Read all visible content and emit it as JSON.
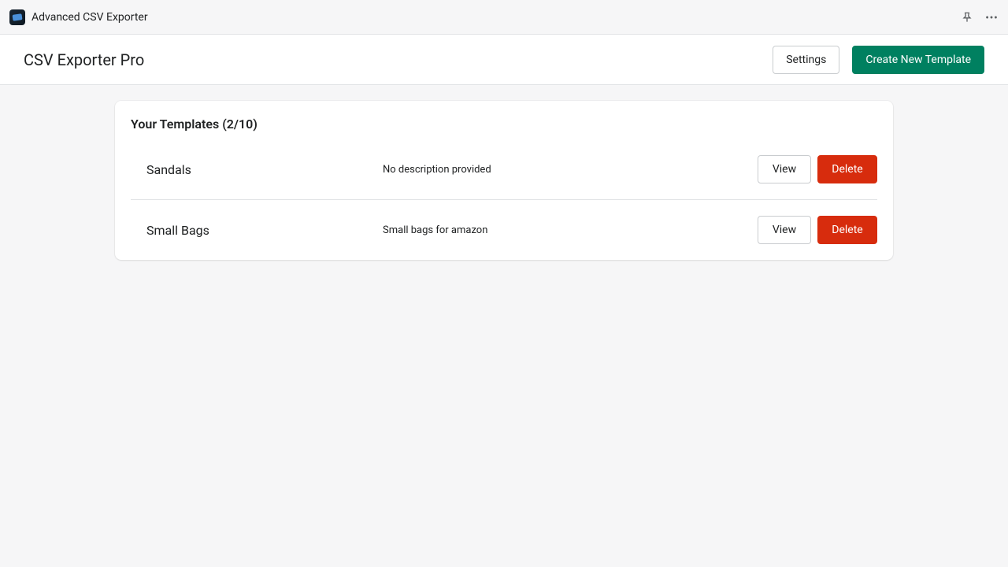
{
  "topbar": {
    "app_title": "Advanced CSV Exporter"
  },
  "header": {
    "page_title": "CSV Exporter Pro",
    "settings_label": "Settings",
    "create_label": "Create New Template"
  },
  "templates": {
    "heading": "Your Templates (2/10)",
    "view_label": "View",
    "delete_label": "Delete",
    "items": [
      {
        "name": "Sandals",
        "description": "No description provided"
      },
      {
        "name": "Small Bags",
        "description": "Small bags for amazon"
      }
    ]
  }
}
